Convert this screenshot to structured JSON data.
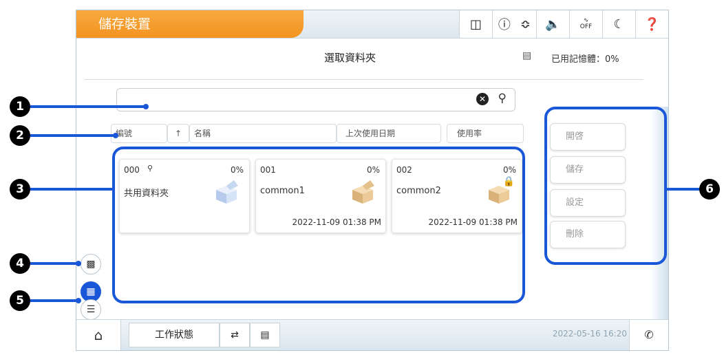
{
  "header": {
    "title": "儲存裝置",
    "icons": [
      "list-status-icon",
      "network-icon",
      "wifi-icon",
      "sound-icon",
      "quiet-off-icon",
      "sleep-icon",
      "help-icon"
    ],
    "quiet_label_top": "",
    "quiet_label_bottom": "OFF"
  },
  "subheader": {
    "page_title": "選取資料夾",
    "memory_label": "已用記憶體：0%"
  },
  "search": {
    "value": "",
    "placeholder": ""
  },
  "columns": {
    "number": "編號",
    "sort_arrow": "↑",
    "name": "名稱",
    "last_used": "上次使用日期",
    "usage": "使用率"
  },
  "folders": [
    {
      "number": "000",
      "pct": "0%",
      "name": "共用資料夾",
      "date": "",
      "box_color": "#c9d9f1",
      "locked": false,
      "pin": true
    },
    {
      "number": "001",
      "pct": "0%",
      "name": "common1",
      "date": "2022-11-09 01:38 PM",
      "box_color": "#e8c99a",
      "locked": false,
      "pin": false
    },
    {
      "number": "002",
      "pct": "0%",
      "name": "common2",
      "date": "2022-11-09 01:38 PM",
      "box_color": "#e8c99a",
      "locked": true,
      "pin": false
    }
  ],
  "side_buttons": {
    "open": "開啓",
    "save": "儲存",
    "settings": "設定",
    "delete": "刪除"
  },
  "bottom": {
    "job_status": "工作狀態",
    "datetime": "2022-05-16 16:20"
  },
  "callouts": [
    "1",
    "2",
    "3",
    "4",
    "5",
    "6"
  ],
  "colors": {
    "accent_orange": "#f39320",
    "highlight_blue": "#1a56d8",
    "view_active": "#1a56d8"
  }
}
